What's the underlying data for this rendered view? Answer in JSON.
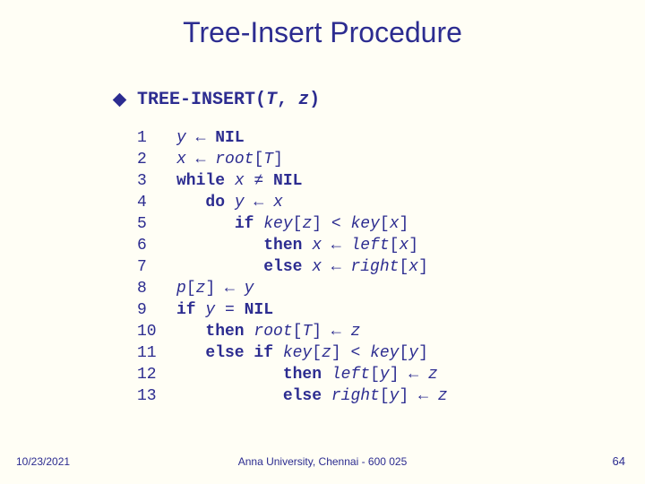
{
  "title": "Tree-Insert Procedure",
  "signature": {
    "name": "TREE-INSERT",
    "open": "(",
    "arg1": "T",
    "sep": ", ",
    "arg2": "z",
    "close": ")"
  },
  "code": [
    {
      "n": "1",
      "segs": [
        {
          "t": "",
          "c": ""
        },
        {
          "t": "y",
          "c": "ital"
        },
        {
          "t": " ← ",
          "c": ""
        },
        {
          "t": "NIL",
          "c": "bold"
        }
      ]
    },
    {
      "n": "2",
      "segs": [
        {
          "t": "",
          "c": ""
        },
        {
          "t": "x",
          "c": "ital"
        },
        {
          "t": " ← ",
          "c": ""
        },
        {
          "t": "root",
          "c": "ital"
        },
        {
          "t": "[",
          "c": ""
        },
        {
          "t": "T",
          "c": "ital"
        },
        {
          "t": "]",
          "c": ""
        }
      ]
    },
    {
      "n": "3",
      "segs": [
        {
          "t": "while ",
          "c": "bold"
        },
        {
          "t": "x",
          "c": "ital"
        },
        {
          "t": " ≠ ",
          "c": ""
        },
        {
          "t": "NIL",
          "c": "bold"
        }
      ]
    },
    {
      "n": "4",
      "segs": [
        {
          "t": "   ",
          "c": ""
        },
        {
          "t": "do ",
          "c": "bold"
        },
        {
          "t": "y",
          "c": "ital"
        },
        {
          "t": " ← ",
          "c": ""
        },
        {
          "t": "x",
          "c": "ital"
        }
      ]
    },
    {
      "n": "5",
      "segs": [
        {
          "t": "      ",
          "c": ""
        },
        {
          "t": "if ",
          "c": "bold"
        },
        {
          "t": "key",
          "c": "ital"
        },
        {
          "t": "[",
          "c": ""
        },
        {
          "t": "z",
          "c": "ital"
        },
        {
          "t": "] < ",
          "c": ""
        },
        {
          "t": "key",
          "c": "ital"
        },
        {
          "t": "[",
          "c": ""
        },
        {
          "t": "x",
          "c": "ital"
        },
        {
          "t": "]",
          "c": ""
        }
      ]
    },
    {
      "n": "6",
      "segs": [
        {
          "t": "         ",
          "c": ""
        },
        {
          "t": "then ",
          "c": "bold"
        },
        {
          "t": "x",
          "c": "ital"
        },
        {
          "t": " ← ",
          "c": ""
        },
        {
          "t": "left",
          "c": "ital"
        },
        {
          "t": "[",
          "c": ""
        },
        {
          "t": "x",
          "c": "ital"
        },
        {
          "t": "]",
          "c": ""
        }
      ]
    },
    {
      "n": "7",
      "segs": [
        {
          "t": "         ",
          "c": ""
        },
        {
          "t": "else ",
          "c": "bold"
        },
        {
          "t": "x",
          "c": "ital"
        },
        {
          "t": " ← ",
          "c": ""
        },
        {
          "t": "right",
          "c": "ital"
        },
        {
          "t": "[",
          "c": ""
        },
        {
          "t": "x",
          "c": "ital"
        },
        {
          "t": "]",
          "c": ""
        }
      ]
    },
    {
      "n": "8",
      "segs": [
        {
          "t": "",
          "c": ""
        },
        {
          "t": "p",
          "c": "ital"
        },
        {
          "t": "[",
          "c": ""
        },
        {
          "t": "z",
          "c": "ital"
        },
        {
          "t": "] ← ",
          "c": ""
        },
        {
          "t": "y",
          "c": "ital"
        }
      ]
    },
    {
      "n": "9",
      "segs": [
        {
          "t": "if ",
          "c": "bold"
        },
        {
          "t": "y",
          "c": "ital"
        },
        {
          "t": " = ",
          "c": ""
        },
        {
          "t": "NIL",
          "c": "bold"
        }
      ]
    },
    {
      "n": "10",
      "segs": [
        {
          "t": "   ",
          "c": ""
        },
        {
          "t": "then ",
          "c": "bold"
        },
        {
          "t": "root",
          "c": "ital"
        },
        {
          "t": "[",
          "c": ""
        },
        {
          "t": "T",
          "c": "ital"
        },
        {
          "t": "] ← ",
          "c": ""
        },
        {
          "t": "z",
          "c": "ital"
        }
      ]
    },
    {
      "n": "11",
      "segs": [
        {
          "t": "   ",
          "c": ""
        },
        {
          "t": "else if ",
          "c": "bold"
        },
        {
          "t": "key",
          "c": "ital"
        },
        {
          "t": "[",
          "c": ""
        },
        {
          "t": "z",
          "c": "ital"
        },
        {
          "t": "] < ",
          "c": ""
        },
        {
          "t": "key",
          "c": "ital"
        },
        {
          "t": "[",
          "c": ""
        },
        {
          "t": "y",
          "c": "ital"
        },
        {
          "t": "]",
          "c": ""
        }
      ]
    },
    {
      "n": "12",
      "segs": [
        {
          "t": "           ",
          "c": ""
        },
        {
          "t": "then ",
          "c": "bold"
        },
        {
          "t": "left",
          "c": "ital"
        },
        {
          "t": "[",
          "c": ""
        },
        {
          "t": "y",
          "c": "ital"
        },
        {
          "t": "] ← ",
          "c": ""
        },
        {
          "t": "z",
          "c": "ital"
        }
      ]
    },
    {
      "n": "13",
      "segs": [
        {
          "t": "           ",
          "c": ""
        },
        {
          "t": "else ",
          "c": "bold"
        },
        {
          "t": "right",
          "c": "ital"
        },
        {
          "t": "[",
          "c": ""
        },
        {
          "t": "y",
          "c": "ital"
        },
        {
          "t": "] ← ",
          "c": ""
        },
        {
          "t": "z",
          "c": "ital"
        }
      ]
    }
  ],
  "footer": {
    "date": "10/23/2021",
    "center": "Anna University, Chennai - 600 025",
    "page": "64"
  }
}
